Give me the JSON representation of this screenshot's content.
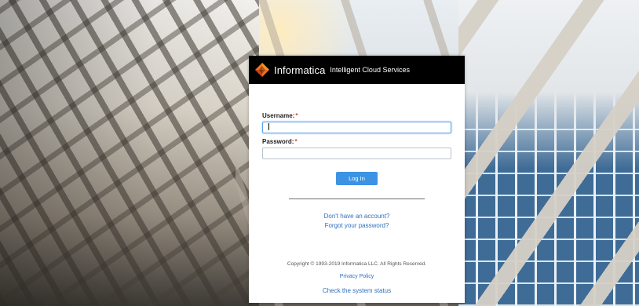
{
  "header": {
    "brand": "Informatica",
    "product": "Intelligent Cloud Services"
  },
  "form": {
    "username_label": "Username:",
    "username_required": "*",
    "username_value": "",
    "password_label": "Password:",
    "password_required": "*",
    "password_value": "",
    "login_label": "Log In"
  },
  "links": {
    "no_account": "Don't have an account?",
    "forgot_password": "Forgot your password?"
  },
  "footer": {
    "copyright": "Copyright © 1993-2019 Informatica LLC. All Rights Reserved.",
    "privacy": "Privacy Policy",
    "status": "Check the system status"
  },
  "colors": {
    "accent": "#3d93e3",
    "link": "#2f6fbf",
    "required": "#d04a2a",
    "logo_orange": "#f26b21"
  },
  "icons": {
    "logo": "informatica-diamond-icon"
  }
}
